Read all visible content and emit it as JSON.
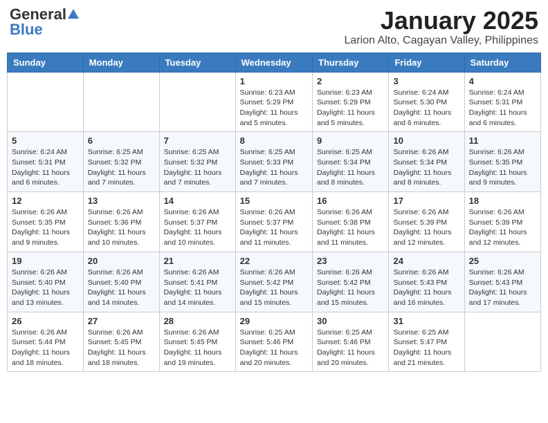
{
  "header": {
    "logo_general": "General",
    "logo_blue": "Blue",
    "month_title": "January 2025",
    "location": "Larion Alto, Cagayan Valley, Philippines"
  },
  "days_of_week": [
    "Sunday",
    "Monday",
    "Tuesday",
    "Wednesday",
    "Thursday",
    "Friday",
    "Saturday"
  ],
  "weeks": [
    [
      {
        "num": "",
        "sunrise": "",
        "sunset": "",
        "daylight": ""
      },
      {
        "num": "",
        "sunrise": "",
        "sunset": "",
        "daylight": ""
      },
      {
        "num": "",
        "sunrise": "",
        "sunset": "",
        "daylight": ""
      },
      {
        "num": "1",
        "sunrise": "Sunrise: 6:23 AM",
        "sunset": "Sunset: 5:29 PM",
        "daylight": "Daylight: 11 hours and 5 minutes."
      },
      {
        "num": "2",
        "sunrise": "Sunrise: 6:23 AM",
        "sunset": "Sunset: 5:29 PM",
        "daylight": "Daylight: 11 hours and 5 minutes."
      },
      {
        "num": "3",
        "sunrise": "Sunrise: 6:24 AM",
        "sunset": "Sunset: 5:30 PM",
        "daylight": "Daylight: 11 hours and 6 minutes."
      },
      {
        "num": "4",
        "sunrise": "Sunrise: 6:24 AM",
        "sunset": "Sunset: 5:31 PM",
        "daylight": "Daylight: 11 hours and 6 minutes."
      }
    ],
    [
      {
        "num": "5",
        "sunrise": "Sunrise: 6:24 AM",
        "sunset": "Sunset: 5:31 PM",
        "daylight": "Daylight: 11 hours and 6 minutes."
      },
      {
        "num": "6",
        "sunrise": "Sunrise: 6:25 AM",
        "sunset": "Sunset: 5:32 PM",
        "daylight": "Daylight: 11 hours and 7 minutes."
      },
      {
        "num": "7",
        "sunrise": "Sunrise: 6:25 AM",
        "sunset": "Sunset: 5:32 PM",
        "daylight": "Daylight: 11 hours and 7 minutes."
      },
      {
        "num": "8",
        "sunrise": "Sunrise: 6:25 AM",
        "sunset": "Sunset: 5:33 PM",
        "daylight": "Daylight: 11 hours and 7 minutes."
      },
      {
        "num": "9",
        "sunrise": "Sunrise: 6:25 AM",
        "sunset": "Sunset: 5:34 PM",
        "daylight": "Daylight: 11 hours and 8 minutes."
      },
      {
        "num": "10",
        "sunrise": "Sunrise: 6:26 AM",
        "sunset": "Sunset: 5:34 PM",
        "daylight": "Daylight: 11 hours and 8 minutes."
      },
      {
        "num": "11",
        "sunrise": "Sunrise: 6:26 AM",
        "sunset": "Sunset: 5:35 PM",
        "daylight": "Daylight: 11 hours and 9 minutes."
      }
    ],
    [
      {
        "num": "12",
        "sunrise": "Sunrise: 6:26 AM",
        "sunset": "Sunset: 5:35 PM",
        "daylight": "Daylight: 11 hours and 9 minutes."
      },
      {
        "num": "13",
        "sunrise": "Sunrise: 6:26 AM",
        "sunset": "Sunset: 5:36 PM",
        "daylight": "Daylight: 11 hours and 10 minutes."
      },
      {
        "num": "14",
        "sunrise": "Sunrise: 6:26 AM",
        "sunset": "Sunset: 5:37 PM",
        "daylight": "Daylight: 11 hours and 10 minutes."
      },
      {
        "num": "15",
        "sunrise": "Sunrise: 6:26 AM",
        "sunset": "Sunset: 5:37 PM",
        "daylight": "Daylight: 11 hours and 11 minutes."
      },
      {
        "num": "16",
        "sunrise": "Sunrise: 6:26 AM",
        "sunset": "Sunset: 5:38 PM",
        "daylight": "Daylight: 11 hours and 11 minutes."
      },
      {
        "num": "17",
        "sunrise": "Sunrise: 6:26 AM",
        "sunset": "Sunset: 5:39 PM",
        "daylight": "Daylight: 11 hours and 12 minutes."
      },
      {
        "num": "18",
        "sunrise": "Sunrise: 6:26 AM",
        "sunset": "Sunset: 5:39 PM",
        "daylight": "Daylight: 11 hours and 12 minutes."
      }
    ],
    [
      {
        "num": "19",
        "sunrise": "Sunrise: 6:26 AM",
        "sunset": "Sunset: 5:40 PM",
        "daylight": "Daylight: 11 hours and 13 minutes."
      },
      {
        "num": "20",
        "sunrise": "Sunrise: 6:26 AM",
        "sunset": "Sunset: 5:40 PM",
        "daylight": "Daylight: 11 hours and 14 minutes."
      },
      {
        "num": "21",
        "sunrise": "Sunrise: 6:26 AM",
        "sunset": "Sunset: 5:41 PM",
        "daylight": "Daylight: 11 hours and 14 minutes."
      },
      {
        "num": "22",
        "sunrise": "Sunrise: 6:26 AM",
        "sunset": "Sunset: 5:42 PM",
        "daylight": "Daylight: 11 hours and 15 minutes."
      },
      {
        "num": "23",
        "sunrise": "Sunrise: 6:26 AM",
        "sunset": "Sunset: 5:42 PM",
        "daylight": "Daylight: 11 hours and 15 minutes."
      },
      {
        "num": "24",
        "sunrise": "Sunrise: 6:26 AM",
        "sunset": "Sunset: 5:43 PM",
        "daylight": "Daylight: 11 hours and 16 minutes."
      },
      {
        "num": "25",
        "sunrise": "Sunrise: 6:26 AM",
        "sunset": "Sunset: 5:43 PM",
        "daylight": "Daylight: 11 hours and 17 minutes."
      }
    ],
    [
      {
        "num": "26",
        "sunrise": "Sunrise: 6:26 AM",
        "sunset": "Sunset: 5:44 PM",
        "daylight": "Daylight: 11 hours and 18 minutes."
      },
      {
        "num": "27",
        "sunrise": "Sunrise: 6:26 AM",
        "sunset": "Sunset: 5:45 PM",
        "daylight": "Daylight: 11 hours and 18 minutes."
      },
      {
        "num": "28",
        "sunrise": "Sunrise: 6:26 AM",
        "sunset": "Sunset: 5:45 PM",
        "daylight": "Daylight: 11 hours and 19 minutes."
      },
      {
        "num": "29",
        "sunrise": "Sunrise: 6:25 AM",
        "sunset": "Sunset: 5:46 PM",
        "daylight": "Daylight: 11 hours and 20 minutes."
      },
      {
        "num": "30",
        "sunrise": "Sunrise: 6:25 AM",
        "sunset": "Sunset: 5:46 PM",
        "daylight": "Daylight: 11 hours and 20 minutes."
      },
      {
        "num": "31",
        "sunrise": "Sunrise: 6:25 AM",
        "sunset": "Sunset: 5:47 PM",
        "daylight": "Daylight: 11 hours and 21 minutes."
      },
      {
        "num": "",
        "sunrise": "",
        "sunset": "",
        "daylight": ""
      }
    ]
  ]
}
